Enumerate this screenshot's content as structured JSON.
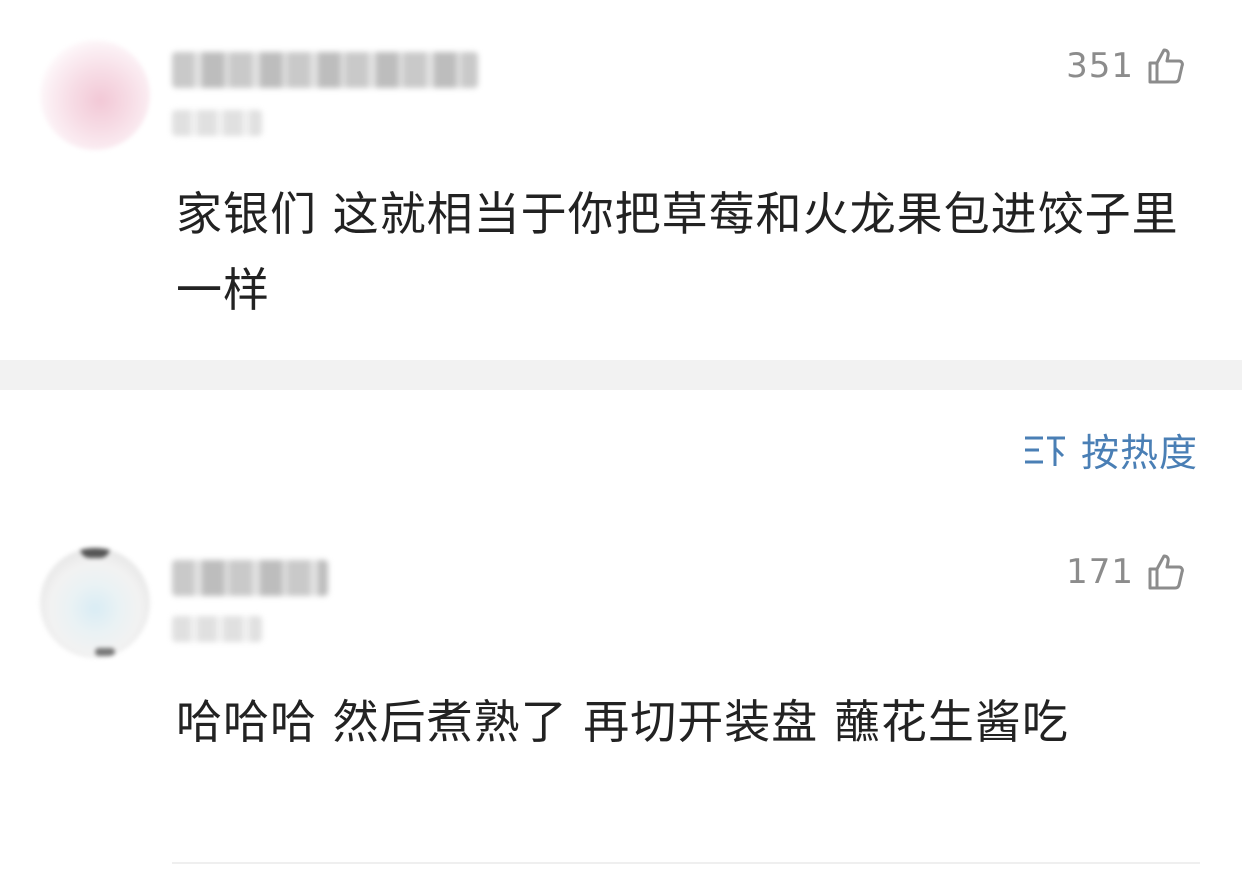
{
  "comments": [
    {
      "like_count": "351",
      "text": "家银们 这就相当于你把草莓和火龙果包进饺子里一样"
    },
    {
      "like_count": "171",
      "text": "哈哈哈 然后煮熟了 再切开装盘 蘸花生酱吃"
    }
  ],
  "sort": {
    "label": "按热度"
  },
  "colors": {
    "accent": "#4a7fb5",
    "like_gray": "#8c8c8c",
    "text": "#222222",
    "divider": "#f2f2f2"
  },
  "icons": {
    "like": "thumbs-up-icon",
    "sort": "sort-icon"
  }
}
